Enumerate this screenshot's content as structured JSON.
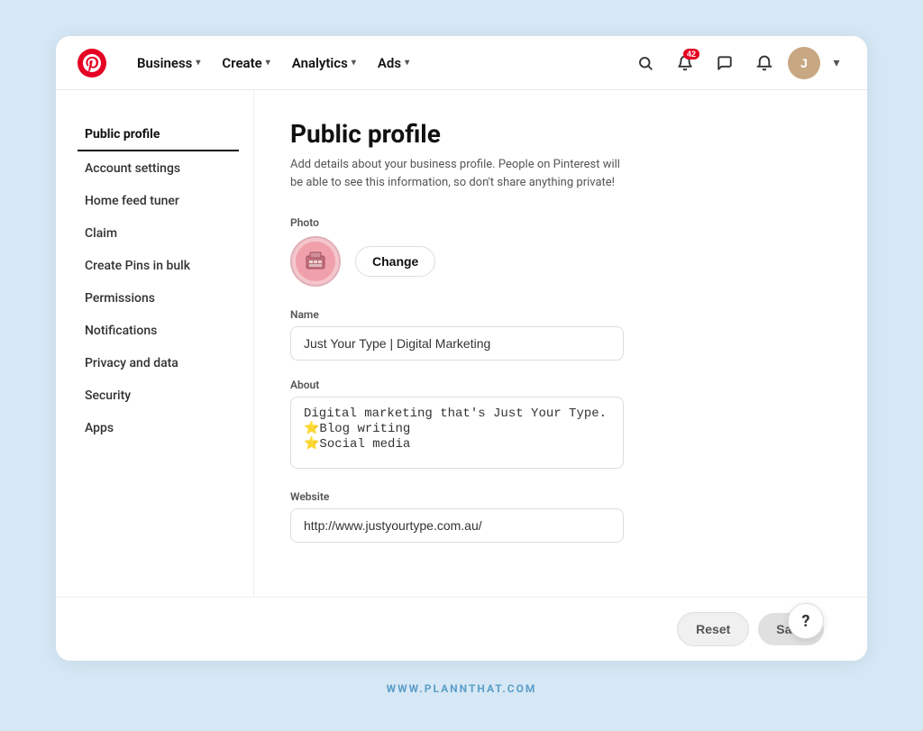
{
  "nav": {
    "logo_alt": "Pinterest",
    "items": [
      {
        "label": "Business",
        "key": "business"
      },
      {
        "label": "Create",
        "key": "create"
      },
      {
        "label": "Analytics",
        "key": "analytics"
      },
      {
        "label": "Ads",
        "key": "ads"
      }
    ],
    "notification_count": "42",
    "avatar_initials": "J"
  },
  "sidebar": {
    "items": [
      {
        "label": "Public profile",
        "key": "public-profile",
        "active": true
      },
      {
        "label": "Account settings",
        "key": "account-settings"
      },
      {
        "label": "Home feed tuner",
        "key": "home-feed-tuner"
      },
      {
        "label": "Claim",
        "key": "claim"
      },
      {
        "label": "Create Pins in bulk",
        "key": "create-pins-bulk"
      },
      {
        "label": "Permissions",
        "key": "permissions"
      },
      {
        "label": "Notifications",
        "key": "notifications"
      },
      {
        "label": "Privacy and data",
        "key": "privacy-data"
      },
      {
        "label": "Security",
        "key": "security"
      },
      {
        "label": "Apps",
        "key": "apps"
      }
    ]
  },
  "content": {
    "title": "Public profile",
    "subtitle": "Add details about your business profile. People on Pinterest will be able to see this information, so don't share anything private!",
    "photo_label": "Photo",
    "change_label": "Change",
    "name_label": "Name",
    "name_value": "Just Your Type | Digital Marketing",
    "about_label": "About",
    "about_value": "Digital marketing that's Just Your Type.\n⭐Blog writing\n⭐Social media",
    "website_label": "Website",
    "website_value": "http://www.justyourtype.com.au/"
  },
  "footer": {
    "reset_label": "Reset",
    "save_label": "Save",
    "help_label": "?"
  },
  "watermark": {
    "text": "WWW.PLANNTHAT.COM"
  }
}
